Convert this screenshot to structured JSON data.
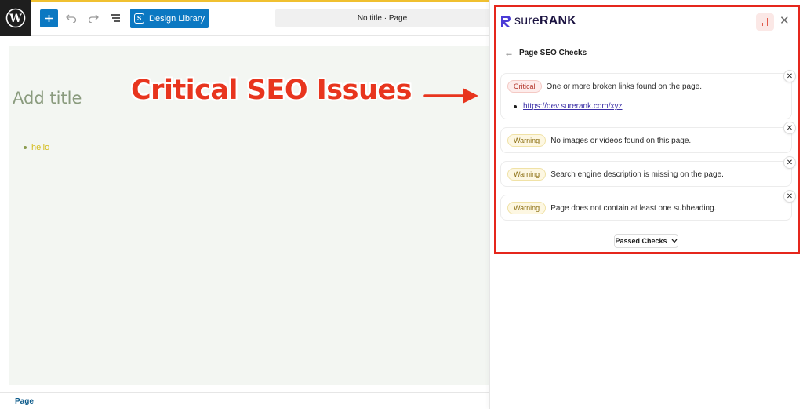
{
  "toolbar": {
    "design_library_label": "Design Library",
    "doc_title": "No title · Page"
  },
  "canvas": {
    "title_placeholder": "Add title",
    "list_items": [
      "hello"
    ]
  },
  "annotation": {
    "text": "Critical SEO Issues"
  },
  "footer": {
    "label": "Page"
  },
  "panel": {
    "brand_sure": "SURE",
    "brand_rank": "RANK",
    "heading": "Page SEO Checks",
    "checks": [
      {
        "badge": "Critical",
        "level": "critical",
        "message": "One or more broken links found on the page.",
        "links": [
          "https://dev.surerank.com/xyz"
        ]
      },
      {
        "badge": "Warning",
        "level": "warning",
        "message": "No images or videos found on this page."
      },
      {
        "badge": "Warning",
        "level": "warning",
        "message": "Search engine description is missing on the page."
      },
      {
        "badge": "Warning",
        "level": "warning",
        "message": "Page does not contain at least one subheading."
      }
    ],
    "passed_label": "Passed Checks"
  },
  "colors": {
    "accent_blue": "#0b78c2",
    "critical_red": "#e5261c",
    "warning_yellow": "#fdf7e2"
  }
}
